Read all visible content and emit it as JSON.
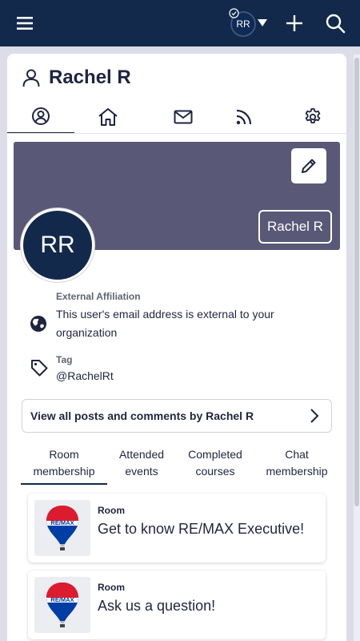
{
  "topbar": {
    "menu_icon": "hamburger-icon",
    "avatar_initials": "RR",
    "plus_icon": "plus-icon",
    "search_icon": "search-icon"
  },
  "profile": {
    "title": "Rachel R",
    "banner_name": "Rachel R",
    "avatar_initials": "RR",
    "banner_color": "#5a5877"
  },
  "tabs": [
    {
      "icon": "user-circle-icon",
      "active": true
    },
    {
      "icon": "home-icon",
      "active": false
    },
    {
      "icon": "mail-icon",
      "active": false
    },
    {
      "icon": "rss-icon",
      "active": false
    },
    {
      "icon": "gear-icon",
      "active": false
    }
  ],
  "info": {
    "affiliation_label": "External Affiliation",
    "affiliation_value": "This user's email address is external to your organization",
    "tag_label": "Tag",
    "tag_value": "@RachelRt"
  },
  "posts_button_label": "View all posts and comments by Rachel R",
  "membership_tabs": [
    {
      "line1": "Room",
      "line2": "membership",
      "active": true
    },
    {
      "line1": "Attended",
      "line2": "events",
      "active": false
    },
    {
      "line1": "Completed",
      "line2": "courses",
      "active": false
    },
    {
      "line1": "Chat",
      "line2": "membership",
      "active": false
    }
  ],
  "rooms": [
    {
      "kind": "Room",
      "name": "Get to know RE/MAX Executive!",
      "logo": "RE/MAX"
    },
    {
      "kind": "Room",
      "name": "Ask us a question!",
      "logo": "RE/MAX"
    }
  ],
  "colors": {
    "navy": "#13294b",
    "accent_red": "#dc1c2e",
    "accent_blue": "#003da5"
  }
}
